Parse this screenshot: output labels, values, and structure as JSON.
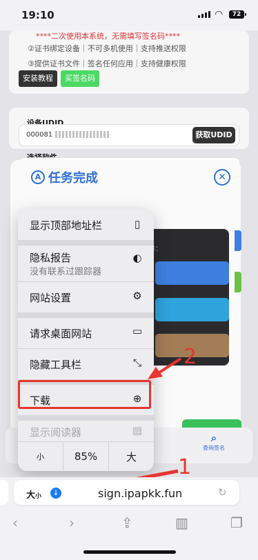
{
  "status": {
    "time": "19:10",
    "battery": "72"
  },
  "page": {
    "notice": "****二次使用本系统，无需填写签名码****",
    "feature_lines": [
      "②证书绑定设备｜不可多机使用｜支持推送权限",
      "③提供证书文件｜签名任何应用｜支持健康权限"
    ],
    "tutorial_button": "安装教程",
    "sign_name_button": "买签名码",
    "udid_label": "设备UDID",
    "udid_value": "000081",
    "get_udid_button": "获取UDID",
    "select_software_label": "选择软件",
    "task_title": "任务完成",
    "panel_caption": "作：",
    "query_sign_label": "查询签名"
  },
  "menu": {
    "items": [
      {
        "label": "显示顶部地址栏",
        "icon": "address-bar-icon"
      },
      {
        "label": "隐私报告",
        "sublabel": "没有联系过跟踪器",
        "icon": "shield-icon"
      },
      {
        "label": "网站设置",
        "icon": "settings-gear-icon"
      },
      {
        "label": "请求桌面网站",
        "icon": "desktop-icon"
      },
      {
        "label": "隐藏工具栏",
        "icon": "expand-arrows-icon"
      },
      {
        "label": "下载",
        "icon": "download-icon"
      },
      {
        "label": "显示阅读器",
        "icon": "reader-icon"
      }
    ],
    "zoom": {
      "smaller": "小",
      "value": "85%",
      "larger": "大"
    }
  },
  "annotations": {
    "step1": "1",
    "step2": "2"
  },
  "toolbar": {
    "text_size_label_big": "大",
    "text_size_label_small": "小",
    "url": "sign.ipapkk.fun"
  },
  "colors": {
    "accent": "#2f6fd6",
    "highlight": "#e8352f",
    "download_blue": "#1a7bf2"
  }
}
